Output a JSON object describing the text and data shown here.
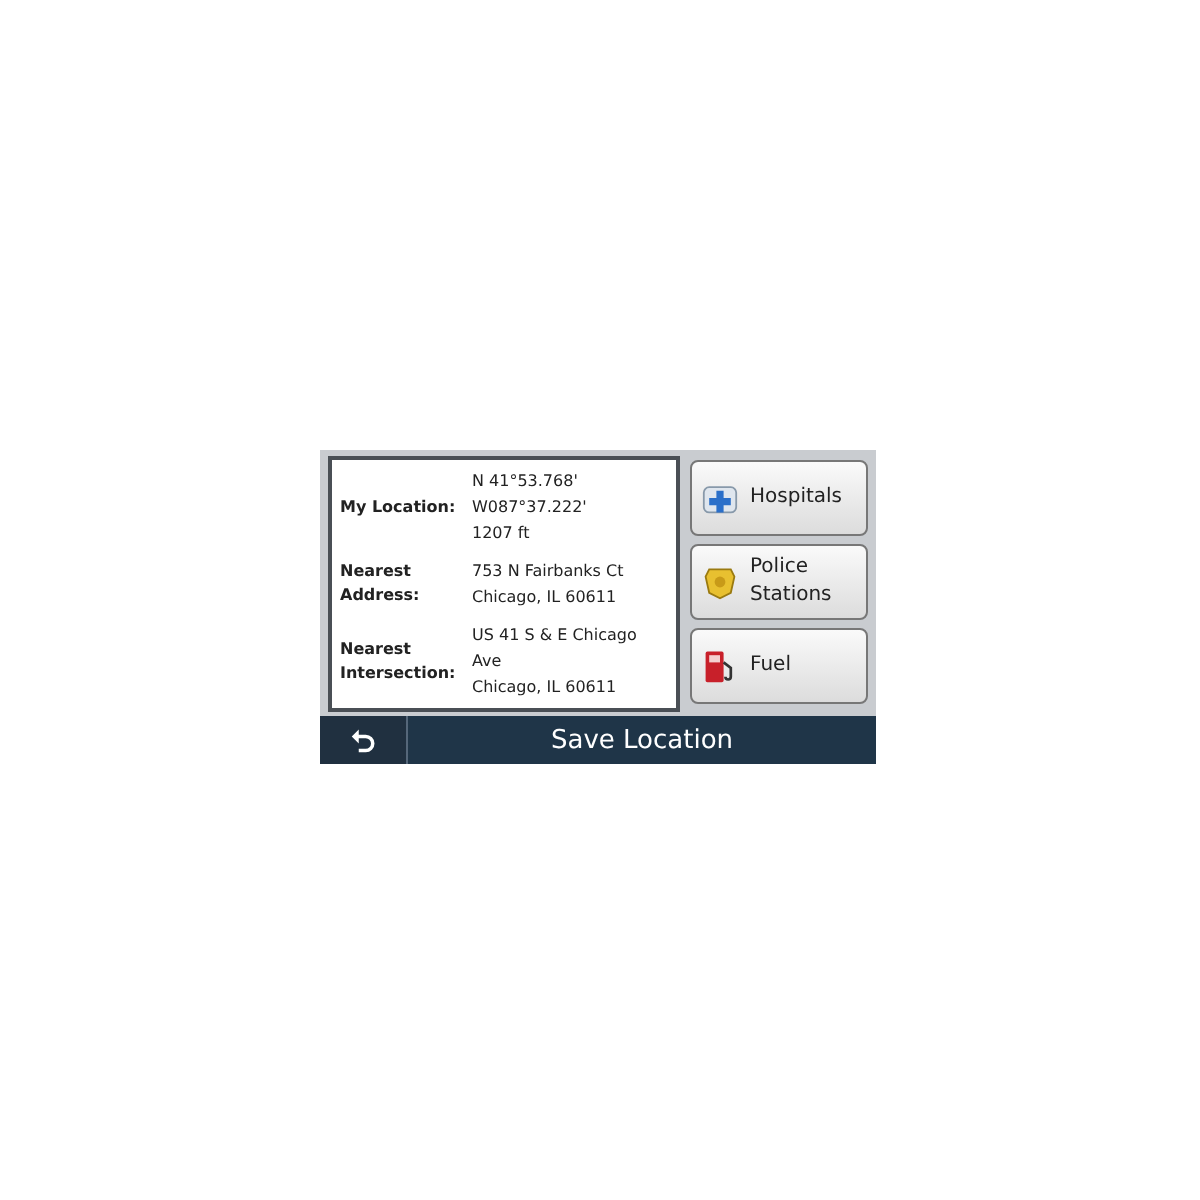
{
  "info": [
    {
      "label": "My Location:",
      "lines": [
        "N 41°53.768'",
        "W087°37.222'",
        "1207 ft"
      ]
    },
    {
      "label": "Nearest Address:",
      "lines": [
        "753 N Fairbanks Ct",
        "Chicago, IL 60611"
      ]
    },
    {
      "label": "Nearest Intersection:",
      "lines": [
        "US 41 S & E Chicago Ave",
        "Chicago, IL 60611"
      ]
    }
  ],
  "buttons": [
    {
      "kind": "hospital",
      "label": "Hospitals"
    },
    {
      "kind": "police",
      "label": "Police Stations"
    },
    {
      "kind": "fuel",
      "label": "Fuel"
    }
  ],
  "bottom_bar": {
    "title": "Save Location"
  }
}
